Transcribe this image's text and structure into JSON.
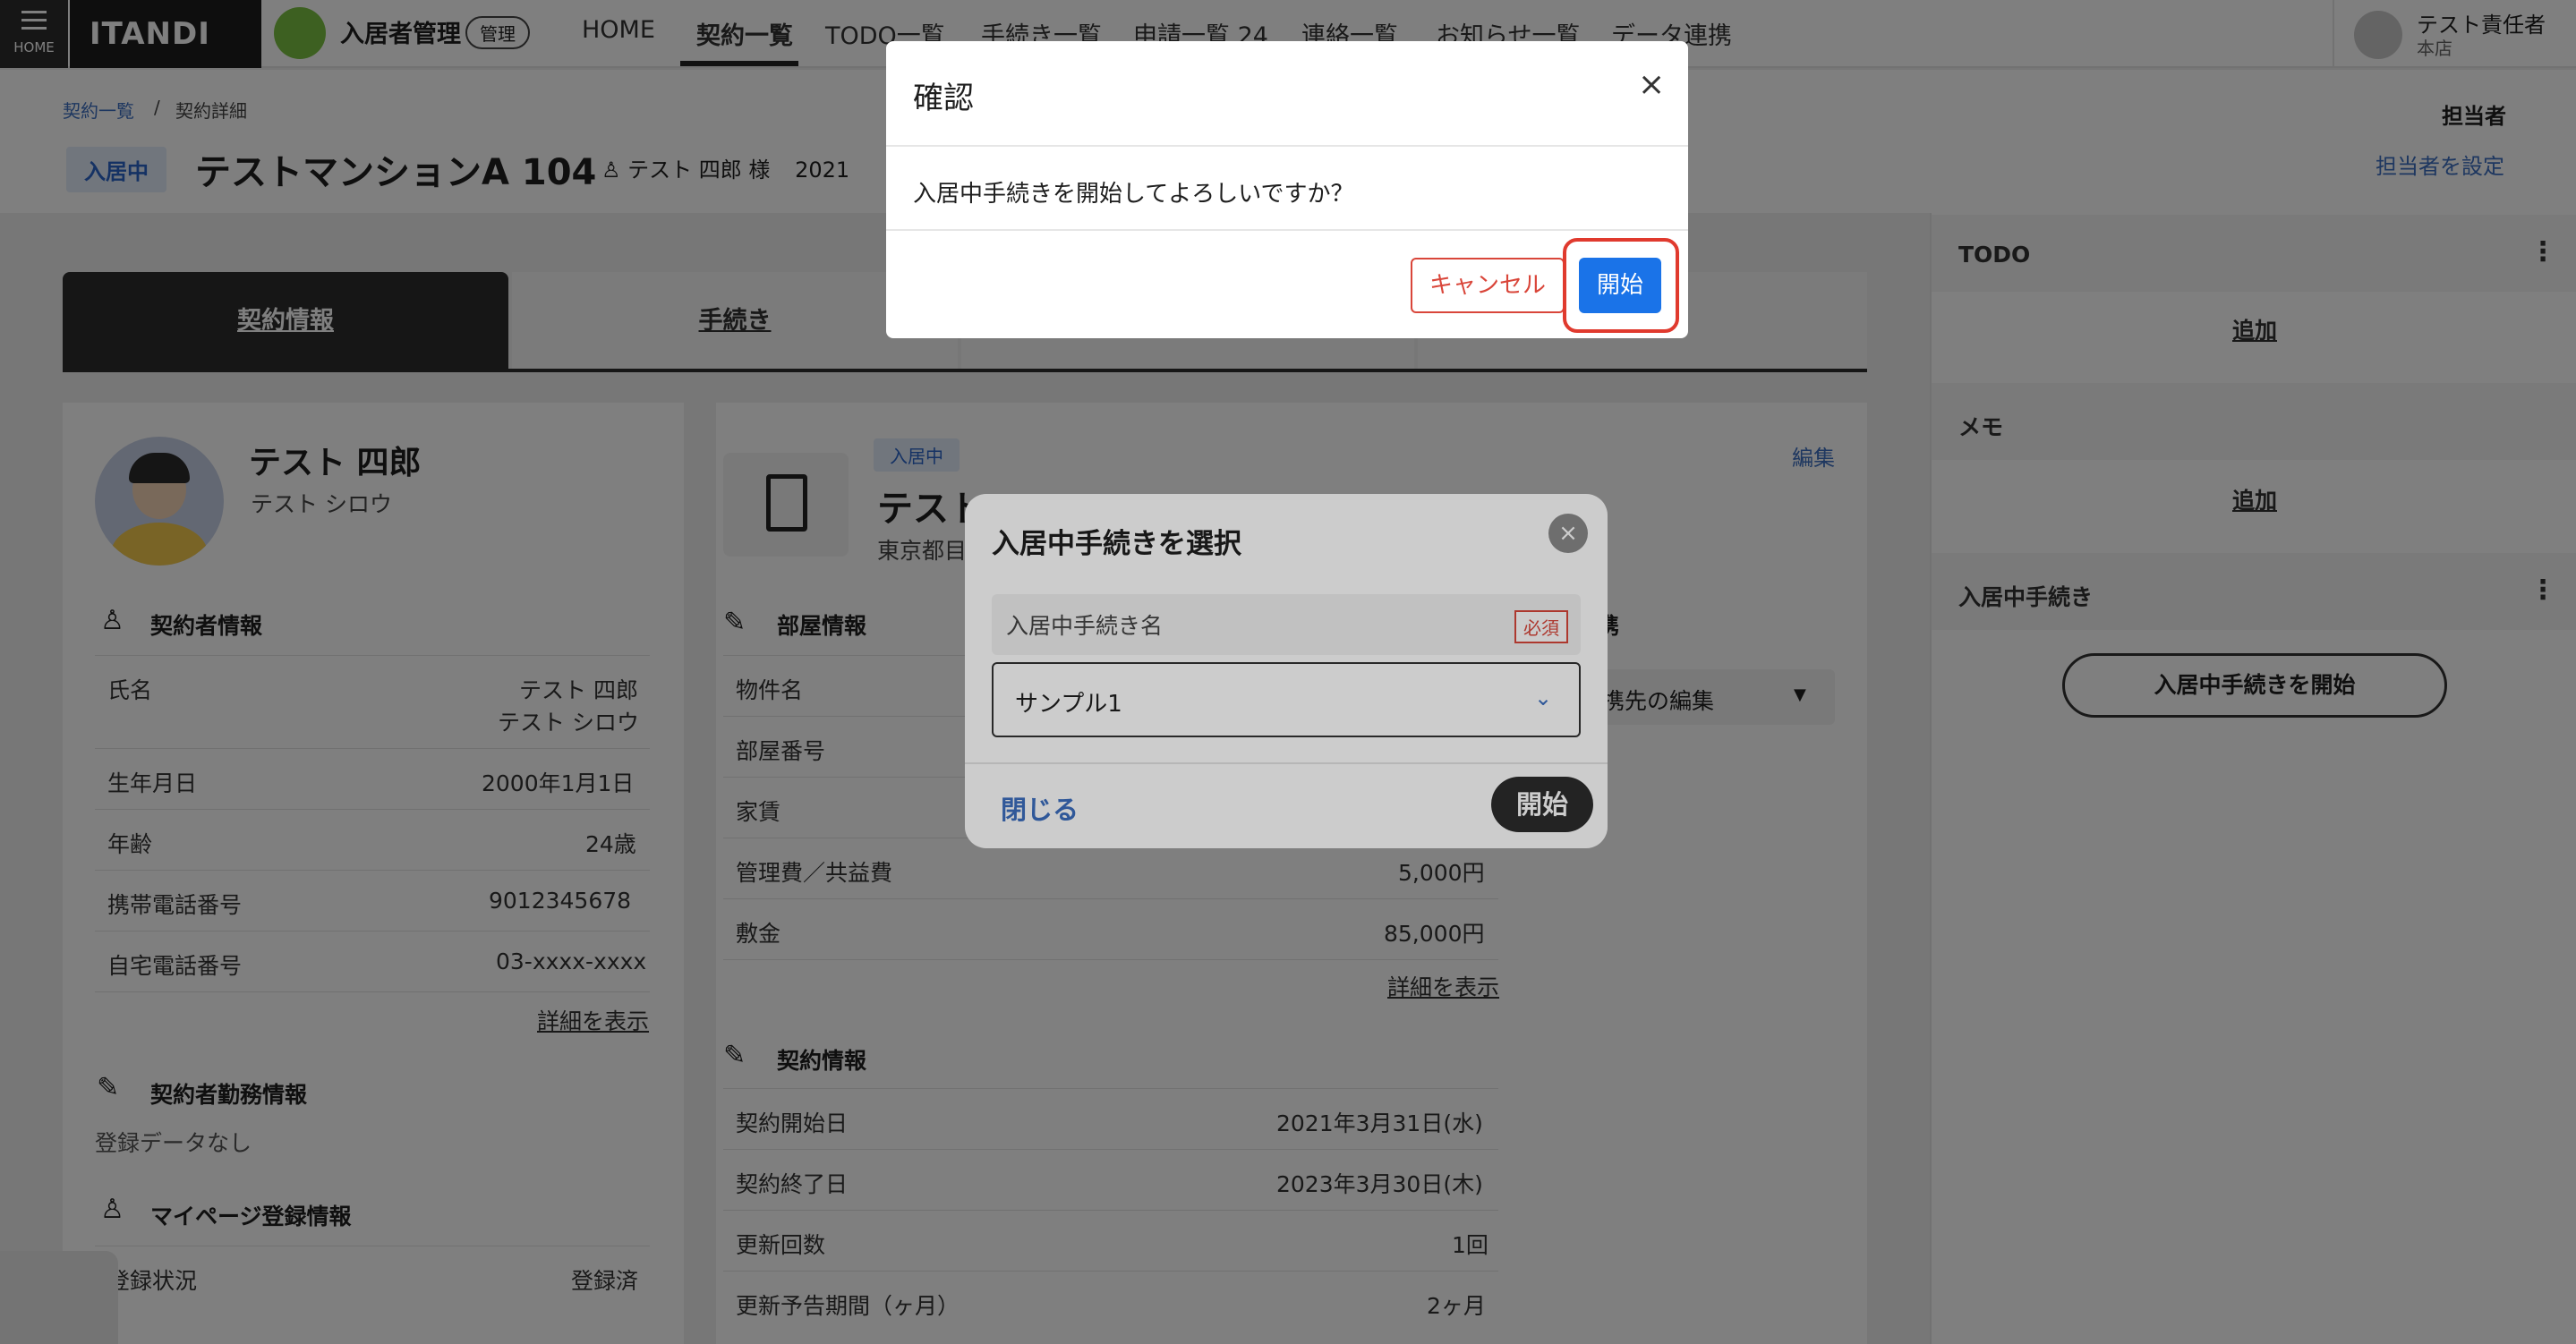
{
  "topnav": {
    "menu_label": "HOME",
    "logo": "ITANDI BB",
    "app_name": "入居者管理",
    "app_tag": "管理",
    "items": [
      "HOME",
      "契約一覧",
      "TODO一覧",
      "手続き一覧",
      "申請一覧 24",
      "連絡一覧",
      "お知らせ一覧",
      "データ連携"
    ],
    "user_name": "テスト責任者",
    "user_store": "本店"
  },
  "header": {
    "breadcrumb": [
      "契約一覧",
      "契約詳細"
    ],
    "status": "入居中",
    "title": "テストマンションA 104",
    "tenant": "テスト 四郎 様",
    "date_fragment": "2021",
    "assignee_label": "担当者",
    "assignee_link": "担当者を設定"
  },
  "tabs": [
    "契約情報",
    "手続き"
  ],
  "tenant": {
    "name": "テスト 四郎",
    "kana": "テスト シロウ",
    "section_contractor": "契約者情報",
    "rows": [
      {
        "label": "氏名",
        "value": "テスト 四郎",
        "value2": "テスト シロウ"
      },
      {
        "label": "生年月日",
        "value": "2000年1月1日"
      },
      {
        "label": "年齢",
        "value": "24歳"
      },
      {
        "label": "携帯電話番号",
        "value": "9012345678"
      },
      {
        "label": "自宅電話番号",
        "value": "03-xxxx-xxxx"
      }
    ],
    "detail_link": "詳細を表示",
    "section_work": "契約者勤務情報",
    "work_empty": "登録データなし",
    "section_mypage": "マイページ登録情報",
    "mypage_label": "登録状況",
    "mypage_value": "登録済"
  },
  "property": {
    "status": "入居中",
    "edit": "編集",
    "title": "テストマ",
    "address": "東京都目",
    "section_room": "部屋情報",
    "room_rows": [
      {
        "label": "物件名",
        "value": ""
      },
      {
        "label": "部屋番号",
        "value": ""
      },
      {
        "label": "家賃",
        "value": ""
      },
      {
        "label": "管理費／共益費",
        "value": "5,000円"
      },
      {
        "label": "敷金",
        "value": "85,000円"
      }
    ],
    "detail_link": "詳細を表示",
    "section_contract": "契約情報",
    "contract_rows": [
      {
        "label": "契約開始日",
        "value": "2021年3月31日(水)"
      },
      {
        "label": "契約終了日",
        "value": "2023年3月30日(木)"
      },
      {
        "label": "更新回数",
        "value": "1回"
      },
      {
        "label": "更新予告期間（ヶ月）",
        "value": "2ヶ月"
      }
    ],
    "partner_fragment": "携",
    "partner_select": "携先の編集"
  },
  "sidebar": {
    "todo_title": "TODO",
    "todo_add": "追加",
    "memo_title": "メモ",
    "memo_add": "追加",
    "proc_title": "入居中手続き",
    "proc_button": "入居中手続きを開始"
  },
  "select_modal": {
    "title": "入居中手続きを選択",
    "close_icon": "×",
    "field_label": "入居中手続き名",
    "required": "必須",
    "selected": "サンプル1",
    "close_link": "閉じる",
    "start": "開始"
  },
  "confirm": {
    "title": "確認",
    "close_icon": "×",
    "message": "入居中手続きを開始してよろしいですか？",
    "cancel": "キャンセル",
    "start": "開始",
    "start_color": "#1a73e8",
    "cancel_color": "#d9463a"
  }
}
